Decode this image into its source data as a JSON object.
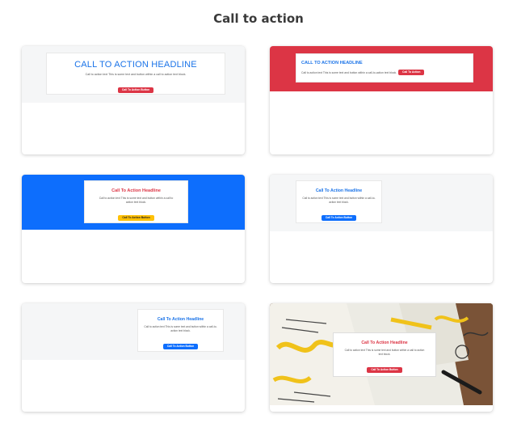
{
  "page": {
    "title": "Call to action"
  },
  "colors": {
    "red": "#dc3545",
    "blue": "#0d6efd",
    "yellow": "#ffc107",
    "grey_band": "#f5f6f7",
    "headline_blue": "#1a73e8"
  },
  "cards": [
    {
      "headline": "CALL TO ACTION HEADLINE",
      "text": "Call to action text This is some text and button within a call to action text block.",
      "button": "Call To Action Button",
      "band": "grey",
      "button_color": "red"
    },
    {
      "headline": "CALL TO ACTION HEADLINE",
      "text": "Call to action text This is some text and button within a call-to-action text block.",
      "button": "Call To Action",
      "band": "red",
      "button_color": "red"
    },
    {
      "headline": "Call To Action Headline",
      "text": "Call to action text This is some text and button within a call to action text block.",
      "button": "Call To Action Button",
      "band": "blue",
      "button_color": "yellow"
    },
    {
      "headline": "Call To Action Headline",
      "text": "Call to action text This is some text and button within a call-to-action text block.",
      "button": "Call To Action Button",
      "band": "grey",
      "button_color": "blue"
    },
    {
      "headline": "Call To Action Headline",
      "text": "Call to action text This is some text and button within a call-to-action text block.",
      "button": "Call To Action Button",
      "band": "grey",
      "button_color": "blue"
    },
    {
      "headline": "Call To Action Headline",
      "text": "Call to action text This is some text and button within a call to action text block.",
      "button": "Call To Action Button",
      "band": "photo",
      "button_color": "red"
    }
  ]
}
